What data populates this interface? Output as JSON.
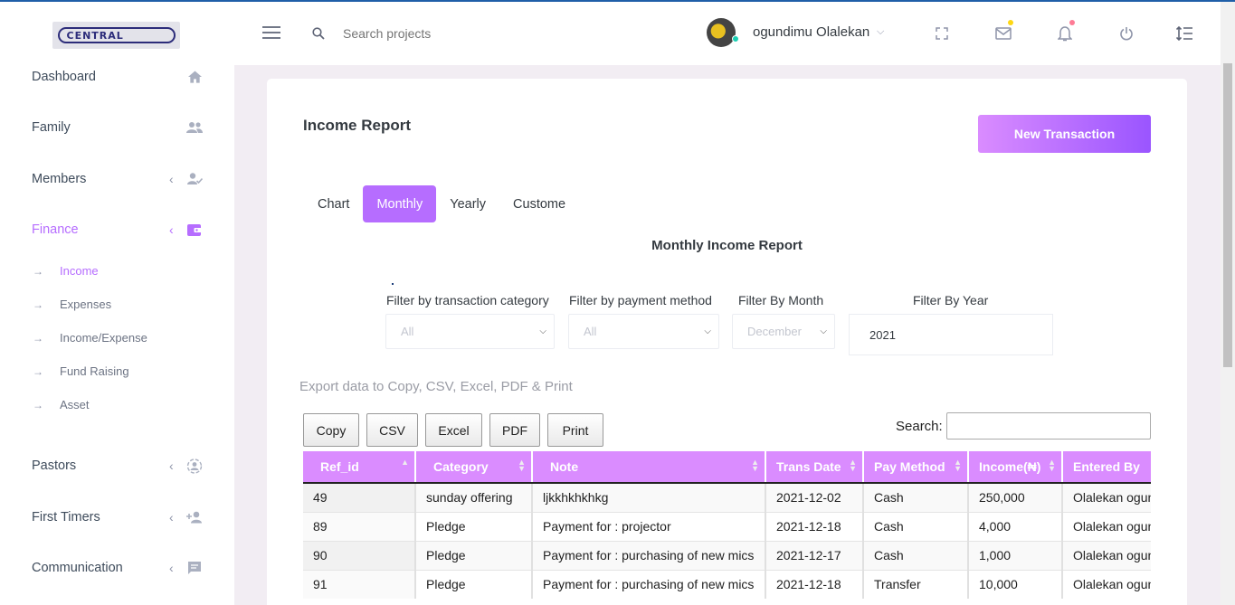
{
  "brand": {
    "logo_text": "CENTRAL"
  },
  "sidebar": {
    "items": [
      {
        "label": "Dashboard"
      },
      {
        "label": "Family"
      },
      {
        "label": "Members"
      },
      {
        "label": "Finance"
      },
      {
        "label": "Pastors"
      },
      {
        "label": "First Timers"
      },
      {
        "label": "Communication"
      }
    ],
    "finance_sub": [
      {
        "label": "Income"
      },
      {
        "label": "Expenses"
      },
      {
        "label": "Income/Expense"
      },
      {
        "label": "Fund Raising"
      },
      {
        "label": "Asset"
      }
    ]
  },
  "header": {
    "search_placeholder": "Search projects",
    "username": "ogundimu Olalekan"
  },
  "page": {
    "title": "Income Report",
    "new_button": "New Transaction",
    "tabs": [
      "Chart",
      "Monthly",
      "Yearly",
      "Custome"
    ],
    "active_tab": "Monthly",
    "subtitle": "Monthly Income Report"
  },
  "filters": {
    "category_label": "Filter by transaction category",
    "category_value": "All",
    "payment_label": "Filter by payment method",
    "payment_value": "All",
    "month_label": "Filter By Month",
    "month_value": "December",
    "year_label": "Filter By Year",
    "year_value": "2021"
  },
  "export": {
    "text": "Export data to Copy, CSV, Excel, PDF & Print",
    "buttons": [
      "Copy",
      "CSV",
      "Excel",
      "PDF",
      "Print"
    ],
    "search_label": "Search:"
  },
  "table": {
    "columns": [
      "Ref_id",
      "Category",
      "Note",
      "Trans Date",
      "Pay Method",
      "Income(₦)",
      "Entered By"
    ],
    "rows": [
      [
        "49",
        "sunday offering",
        "ljkkhkhkhkg",
        "2021-12-02",
        "Cash",
        "250,000",
        "Olalekan ogundimu"
      ],
      [
        "89",
        "Pledge",
        "Payment for : projector",
        "2021-12-18",
        "Cash",
        "4,000",
        "Olalekan ogundimu"
      ],
      [
        "90",
        "Pledge",
        "Payment for : purchasing of new mics",
        "2021-12-17",
        "Cash",
        "1,000",
        "Olalekan ogundimu"
      ],
      [
        "91",
        "Pledge",
        "Payment for : purchasing of new mics",
        "2021-12-18",
        "Transfer",
        "10,000",
        "Olalekan ogundimu"
      ]
    ]
  },
  "colors": {
    "accent": "#b66dff",
    "header_row": "#da8cff",
    "mail_dot": "#fed713",
    "bell_dot": "#fe7c96",
    "online": "#1bcfb4"
  }
}
